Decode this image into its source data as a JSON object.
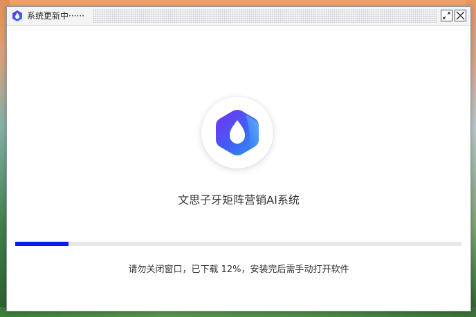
{
  "window": {
    "title": "系统更新中······"
  },
  "app": {
    "name": "文思子牙矩阵营销AI系统",
    "logo_icon": "water-drop-hexagon-logo"
  },
  "progress": {
    "percent": 12,
    "status_text": "请勿关闭窗口，已下载 12%，安装完后需手动打开软件"
  },
  "colors": {
    "progress_fill": "#0c1ee3",
    "progress_track": "#e7e8ea",
    "logo_gradient_start": "#7b2ff7",
    "logo_gradient_end": "#2d9cf5"
  },
  "icons": {
    "app_icon": "hexagon-logo-icon",
    "restore": "restore-icon",
    "close": "close-icon"
  }
}
